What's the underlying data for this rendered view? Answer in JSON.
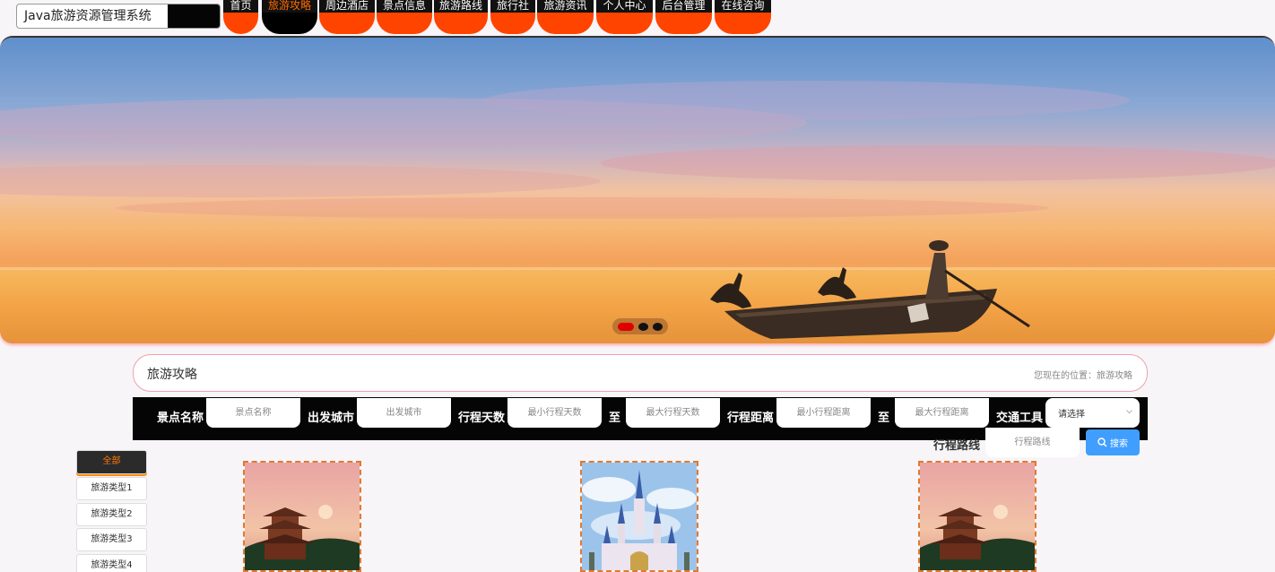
{
  "brand": {
    "title": "Java旅游资源管理系统"
  },
  "nav": {
    "items": [
      {
        "label": "首页",
        "active": false
      },
      {
        "label": "旅游攻略",
        "active": true
      },
      {
        "label": "周边酒店",
        "active": false
      },
      {
        "label": "景点信息",
        "active": false
      },
      {
        "label": "旅游路线",
        "active": false
      },
      {
        "label": "旅行社",
        "active": false
      },
      {
        "label": "旅游资讯",
        "active": false
      },
      {
        "label": "个人中心",
        "active": false
      },
      {
        "label": "后台管理",
        "active": false
      },
      {
        "label": "在线咨询",
        "active": false
      }
    ]
  },
  "carousel": {
    "slide_count": 3,
    "active_index": 0
  },
  "section": {
    "title": "旅游攻略",
    "location": "您现在的位置：旅游攻略"
  },
  "filters": {
    "spot_name_label": "景点名称",
    "spot_name_placeholder": "景点名称",
    "city_label": "出发城市",
    "city_placeholder": "出发城市",
    "days_label": "行程天数",
    "days_min_placeholder": "最小行程天数",
    "to_1": "至",
    "days_max_placeholder": "最大行程天数",
    "distance_label": "行程距离",
    "distance_min_placeholder": "最小行程距离",
    "to_2": "至",
    "distance_max_placeholder": "最大行程距离",
    "transport_label": "交通工具",
    "transport_value": "请选择",
    "route_label": "行程路线",
    "route_placeholder": "行程路线",
    "search_button": "搜索"
  },
  "categories": [
    {
      "label": "全部",
      "active": true
    },
    {
      "label": "旅游类型1",
      "active": false
    },
    {
      "label": "旅游类型2",
      "active": false
    },
    {
      "label": "旅游类型3",
      "active": false
    },
    {
      "label": "旅游类型4",
      "active": false
    }
  ],
  "cards": [
    {
      "image": "pagoda"
    },
    {
      "image": "castle"
    },
    {
      "image": "pagoda"
    }
  ],
  "colors": {
    "accent": "#ff4400",
    "nav_active_text": "#ff6a00",
    "search_button": "#409eff"
  }
}
